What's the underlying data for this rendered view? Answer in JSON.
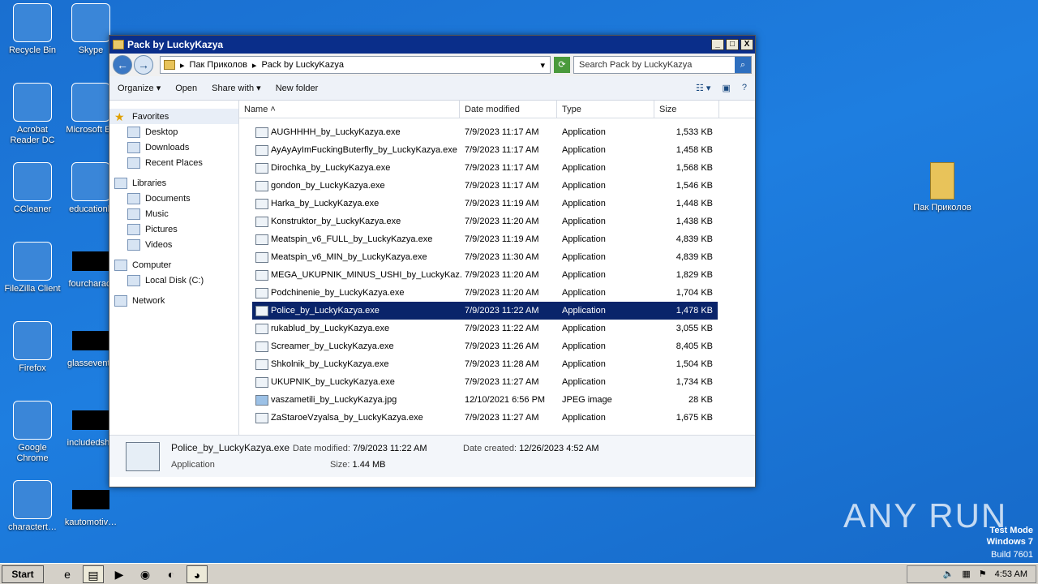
{
  "desktop": {
    "icons_left": [
      {
        "label": "Recycle Bin",
        "icon": "recycle-bin-icon"
      },
      {
        "label": "Acrobat Reader DC",
        "icon": "acrobat-icon"
      },
      {
        "label": "CCleaner",
        "icon": "ccleaner-icon"
      },
      {
        "label": "FileZilla Client",
        "icon": "filezilla-icon"
      },
      {
        "label": "Firefox",
        "icon": "firefox-icon"
      },
      {
        "label": "Google Chrome",
        "icon": "chrome-icon"
      },
      {
        "label": "charactert…",
        "icon": "shortcut-icon"
      }
    ],
    "icons_col2": [
      {
        "label": "Skype",
        "icon": "skype-icon"
      },
      {
        "label": "Microsoft Ed",
        "icon": "edge-icon"
      },
      {
        "label": "educationb",
        "icon": "word-doc-icon"
      },
      {
        "label": "fourcharact",
        "icon": "file-icon"
      },
      {
        "label": "glassevents",
        "icon": "file-icon"
      },
      {
        "label": "includedsha",
        "icon": "file-icon"
      },
      {
        "label": "kautomotiv…",
        "icon": "file-icon"
      }
    ],
    "right_icon": {
      "label": "Пак Приколов",
      "icon": "folder-icon"
    },
    "watermark": {
      "brand": "ANY RUN",
      "line1": "Test Mode",
      "line2": "Windows 7",
      "line3": "Build 7601"
    }
  },
  "window": {
    "title": "Pack by LuckyKazya",
    "controls": [
      "_",
      "□",
      "X"
    ],
    "breadcrumb": [
      "Пак Приколов",
      "Pack by LuckyKazya"
    ],
    "search_placeholder": "Search Pack by LuckyKazya",
    "toolbar": {
      "organize": "Organize",
      "open": "Open",
      "share": "Share with",
      "new_folder": "New folder"
    },
    "nav": {
      "favorites": "Favorites",
      "fav_items": [
        "Desktop",
        "Downloads",
        "Recent Places"
      ],
      "libraries": "Libraries",
      "lib_items": [
        "Documents",
        "Music",
        "Pictures",
        "Videos"
      ],
      "computer": "Computer",
      "comp_items": [
        "Local Disk (C:)"
      ],
      "network": "Network"
    },
    "columns": {
      "name": "Name",
      "date": "Date modified",
      "type": "Type",
      "size": "Size"
    },
    "files": [
      {
        "name": "AUGHHHH_by_LuckyKazya.exe",
        "date": "7/9/2023 11:17 AM",
        "type": "Application",
        "size": "1,533 KB"
      },
      {
        "name": "AyAyAyImFuckingButerfly_by_LuckyKazya.exe",
        "date": "7/9/2023 11:17 AM",
        "type": "Application",
        "size": "1,458 KB"
      },
      {
        "name": "Dirochka_by_LuckyKazya.exe",
        "date": "7/9/2023 11:17 AM",
        "type": "Application",
        "size": "1,568 KB"
      },
      {
        "name": "gondon_by_LuckyKazya.exe",
        "date": "7/9/2023 11:17 AM",
        "type": "Application",
        "size": "1,546 KB"
      },
      {
        "name": "Harka_by_LuckyKazya.exe",
        "date": "7/9/2023 11:19 AM",
        "type": "Application",
        "size": "1,448 KB"
      },
      {
        "name": "Konstruktor_by_LuckyKazya.exe",
        "date": "7/9/2023 11:20 AM",
        "type": "Application",
        "size": "1,438 KB"
      },
      {
        "name": "Meatspin_v6_FULL_by_LuckyKazya.exe",
        "date": "7/9/2023 11:19 AM",
        "type": "Application",
        "size": "4,839 KB"
      },
      {
        "name": "Meatspin_v6_MIN_by_LuckyKazya.exe",
        "date": "7/9/2023 11:30 AM",
        "type": "Application",
        "size": "4,839 KB"
      },
      {
        "name": "MEGA_UKUPNIK_MINUS_USHI_by_LuckyKaz...",
        "date": "7/9/2023 11:20 AM",
        "type": "Application",
        "size": "1,829 KB"
      },
      {
        "name": "Podchinenie_by_LuckyKazya.exe",
        "date": "7/9/2023 11:20 AM",
        "type": "Application",
        "size": "1,704 KB"
      },
      {
        "name": "Police_by_LuckyKazya.exe",
        "date": "7/9/2023 11:22 AM",
        "type": "Application",
        "size": "1,478 KB"
      },
      {
        "name": "rukablud_by_LuckyKazya.exe",
        "date": "7/9/2023 11:22 AM",
        "type": "Application",
        "size": "3,055 KB"
      },
      {
        "name": "Screamer_by_LuckyKazya.exe",
        "date": "7/9/2023 11:26 AM",
        "type": "Application",
        "size": "8,405 KB"
      },
      {
        "name": "Shkolnik_by_LuckyKazya.exe",
        "date": "7/9/2023 11:28 AM",
        "type": "Application",
        "size": "1,504 KB"
      },
      {
        "name": "UKUPNIK_by_LuckyKazya.exe",
        "date": "7/9/2023 11:27 AM",
        "type": "Application",
        "size": "1,734 KB"
      },
      {
        "name": "vaszametili_by_LuckyKazya.jpg",
        "date": "12/10/2021 6:56 PM",
        "type": "JPEG image",
        "size": "28 KB"
      },
      {
        "name": "ZaStaroeVzyalsa_by_LuckyKazya.exe",
        "date": "7/9/2023 11:27 AM",
        "type": "Application",
        "size": "1,675 KB"
      }
    ],
    "selected_index": 10,
    "details": {
      "name": "Police_by_LuckyKazya.exe",
      "type": "Application",
      "modified_label": "Date modified:",
      "modified": "7/9/2023 11:22 AM",
      "created_label": "Date created:",
      "created": "12/26/2023 4:52 AM",
      "size_label": "Size:",
      "size": "1.44 MB"
    }
  },
  "taskbar": {
    "start": "Start",
    "time": "4:53 AM"
  }
}
